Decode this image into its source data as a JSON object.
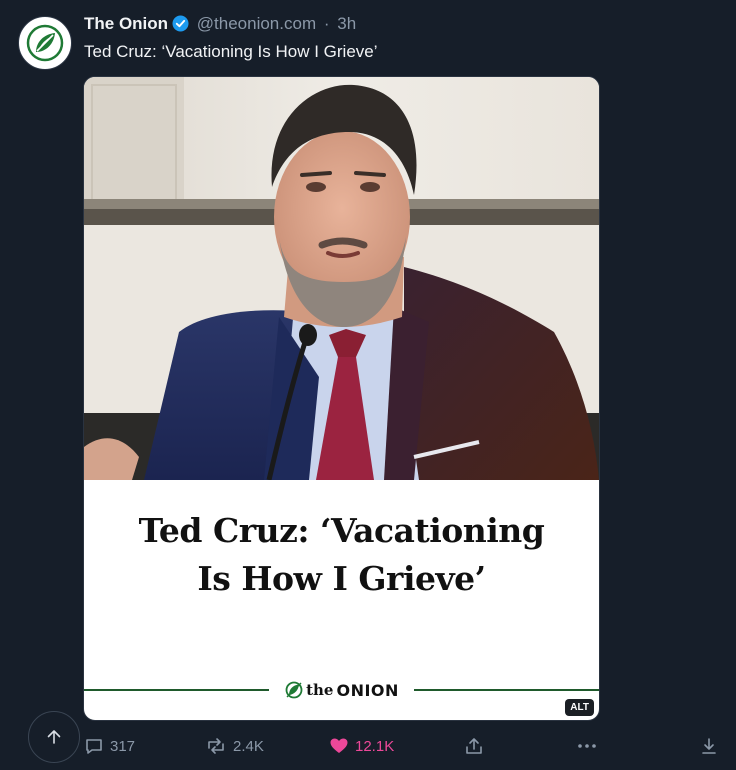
{
  "post": {
    "author_name": "The Onion",
    "handle": "@theonion.com",
    "separator": "·",
    "time": "3h",
    "text": "Ted Cruz: ‘Vacationing Is How I Grieve’"
  },
  "card": {
    "headline_line1": "Ted Cruz: ‘Vacationing",
    "headline_line2": "Is How I Grieve’",
    "brand_the": "the",
    "brand_onion": "ONION",
    "alt_badge": "ALT"
  },
  "actions": {
    "replies": "317",
    "reposts": "2.4K",
    "likes": "12.1K"
  },
  "colors": {
    "background": "#161e29",
    "verified": "#1d9bf0",
    "like": "#ec4899",
    "onion_green": "#1f7a35",
    "muted": "#8b98a8"
  },
  "icons": [
    "onion-logo-icon",
    "verified-badge-icon",
    "reply-icon",
    "repost-icon",
    "heart-icon",
    "share-icon",
    "more-icon",
    "download-icon",
    "arrow-up-icon"
  ]
}
